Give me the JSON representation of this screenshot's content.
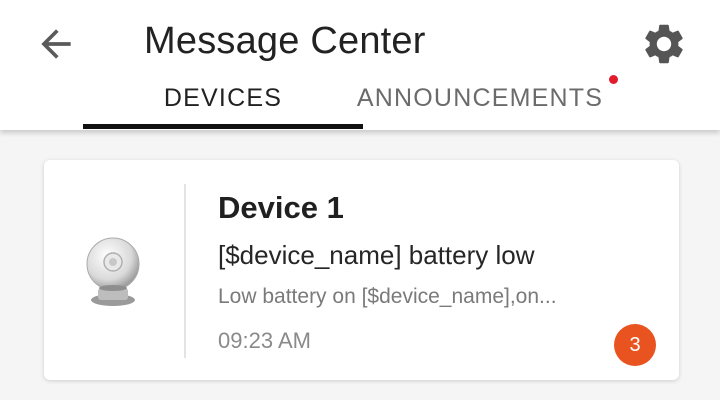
{
  "header": {
    "title": "Message Center",
    "back_icon": "arrow-left-icon",
    "settings_icon": "gear-icon"
  },
  "tabs": [
    {
      "label": "DEVICES",
      "active": true
    },
    {
      "label": "ANNOUNCEMENTS",
      "active": false,
      "has_notification": true
    }
  ],
  "messages": [
    {
      "device_name": "Device 1",
      "device_icon": "camera-device-icon",
      "title": "[$device_name] battery low",
      "preview": "Low battery on [$device_name],on...",
      "time": "09:23 AM",
      "unread_count": "3"
    }
  ],
  "colors": {
    "tab_indicator": "#111111",
    "notification_dot": "#e21b2e",
    "badge": "#e8531f",
    "icon_gray": "#555555"
  }
}
